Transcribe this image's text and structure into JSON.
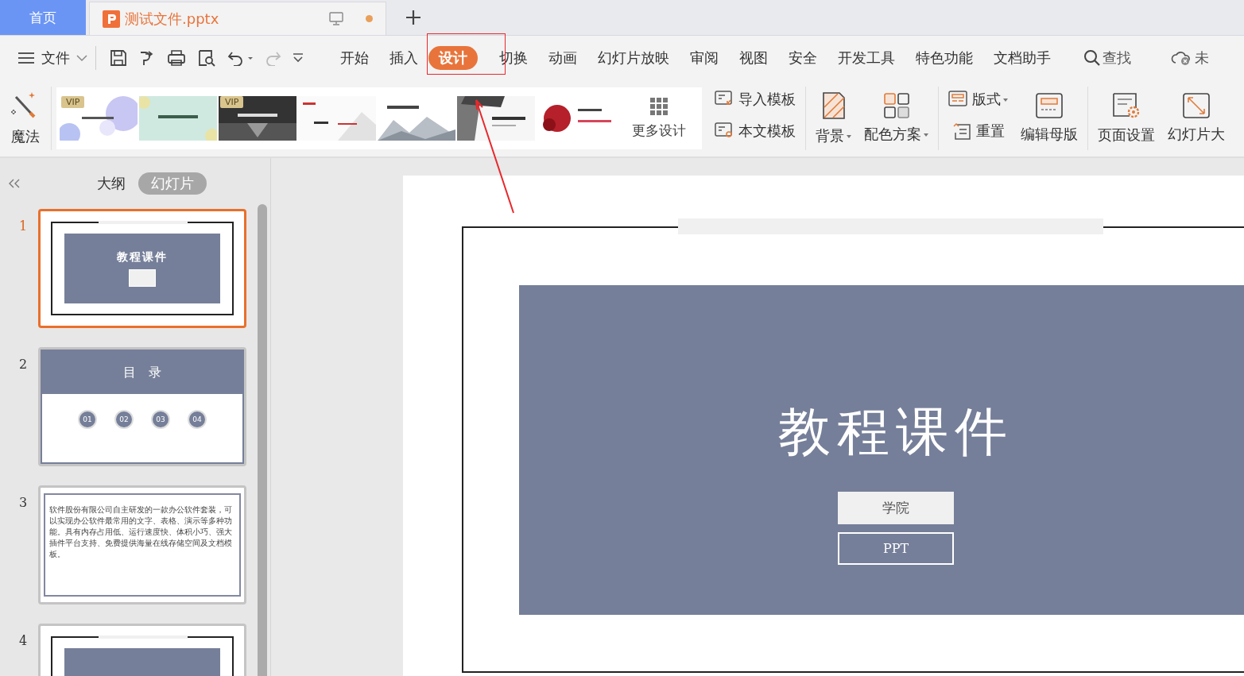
{
  "doc_tabs": [
    {
      "label": "首页",
      "kind": "home",
      "selected": false
    },
    {
      "label": "测试文件.pptx",
      "kind": "doc",
      "selected": true
    }
  ],
  "menu": {
    "file_label": "文件",
    "ribbon_tabs": [
      {
        "label": "开始",
        "selected": false
      },
      {
        "label": "插入",
        "selected": false
      },
      {
        "label": "设计",
        "selected": true
      },
      {
        "label": "切换",
        "selected": false
      },
      {
        "label": "动画",
        "selected": false
      },
      {
        "label": "幻灯片放映",
        "selected": false
      },
      {
        "label": "审阅",
        "selected": false
      },
      {
        "label": "视图",
        "selected": false
      },
      {
        "label": "安全",
        "selected": false
      },
      {
        "label": "开发工具",
        "selected": false
      },
      {
        "label": "特色功能",
        "selected": false
      },
      {
        "label": "文档助手",
        "selected": false
      }
    ],
    "search_label": "查找",
    "cloud_label": "未"
  },
  "ribbon": {
    "magic_label": "魔法",
    "templates": [
      {
        "kind": "picture",
        "vip": "VIP"
      },
      {
        "kind": "picture"
      },
      {
        "kind": "picture",
        "vip": "VIP"
      },
      {
        "kind": "picture"
      },
      {
        "kind": "picture"
      },
      {
        "kind": "picture"
      },
      {
        "kind": "picture"
      }
    ],
    "more_label": "更多设计",
    "tools": [
      {
        "label": "导入模板",
        "kind": "small"
      },
      {
        "label": "本文模板",
        "kind": "small"
      },
      {
        "label": "背景",
        "kind": "large",
        "dropdown": true
      },
      {
        "label": "配色方案",
        "kind": "large",
        "dropdown": true
      },
      {
        "label": "版式",
        "kind": "small",
        "dropdown": true
      },
      {
        "label": "重置",
        "kind": "small",
        "dropdown": false
      },
      {
        "label": "编辑母版",
        "kind": "large",
        "dropdown": false
      },
      {
        "label": "页面设置",
        "kind": "large",
        "dropdown": false
      },
      {
        "label": "幻灯片大",
        "kind": "large",
        "dropdown": false
      }
    ]
  },
  "panel": {
    "views": [
      {
        "label": "大纲",
        "selected": false
      },
      {
        "label": "幻灯片",
        "selected": true
      }
    ],
    "slides": [
      {
        "number": "1",
        "selected": true,
        "kind": "title",
        "title": "教程课件"
      },
      {
        "number": "2",
        "selected": false,
        "kind": "toc",
        "title": "目　录",
        "items": [
          "01",
          "02",
          "03",
          "04"
        ]
      },
      {
        "number": "3",
        "selected": false,
        "kind": "text",
        "body": "软件股份有限公司自主研发的一款办公软件套装，可以实现办公软件最常用的文字、表格、演示等多种功能。具有内存占用低、运行速度快、体积小巧、强大插件平台支持、免费提供海量在线存储空间及文档模板。"
      },
      {
        "number": "4",
        "selected": false,
        "kind": "title"
      }
    ]
  },
  "slide": {
    "title": "教程课件",
    "subtitle": "学院",
    "tag": "PPT"
  }
}
